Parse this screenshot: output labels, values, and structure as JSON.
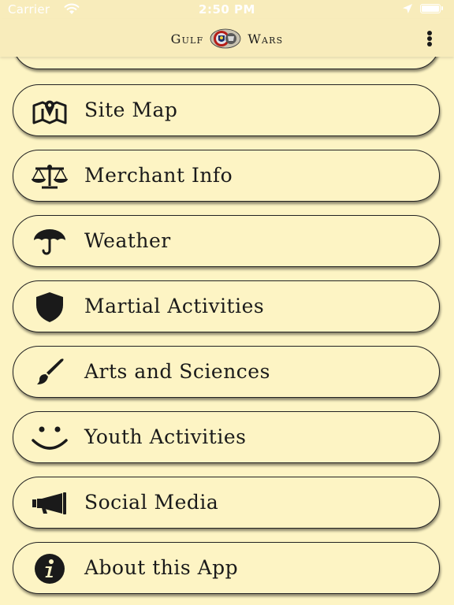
{
  "status_bar": {
    "carrier": "Carrier",
    "time": "2:50 PM",
    "wifi_icon": "wifi-icon",
    "location_icon": "location-arrow-icon",
    "battery_icon": "battery-icon"
  },
  "nav": {
    "title_left": "Gulf",
    "title_right": "Wars",
    "crest_icon": "gulf-wars-crest-icon",
    "menu_icon": "vertical-ellipsis-icon"
  },
  "menu": {
    "items": [
      {
        "label": "Site Map",
        "icon": "map-icon"
      },
      {
        "label": "Merchant Info",
        "icon": "balance-scale-icon"
      },
      {
        "label": "Weather",
        "icon": "umbrella-icon"
      },
      {
        "label": "Martial Activities",
        "icon": "shield-icon"
      },
      {
        "label": "Arts and Sciences",
        "icon": "paint-brush-icon"
      },
      {
        "label": "Youth Activities",
        "icon": "smile-icon"
      },
      {
        "label": "Social Media",
        "icon": "bullhorn-icon"
      },
      {
        "label": "About this App",
        "icon": "info-circle-icon"
      }
    ]
  },
  "colors": {
    "background": "#fdf4c4",
    "nav_background": "#f8ecbb",
    "text": "#1a1a1a",
    "border": "#222222"
  }
}
